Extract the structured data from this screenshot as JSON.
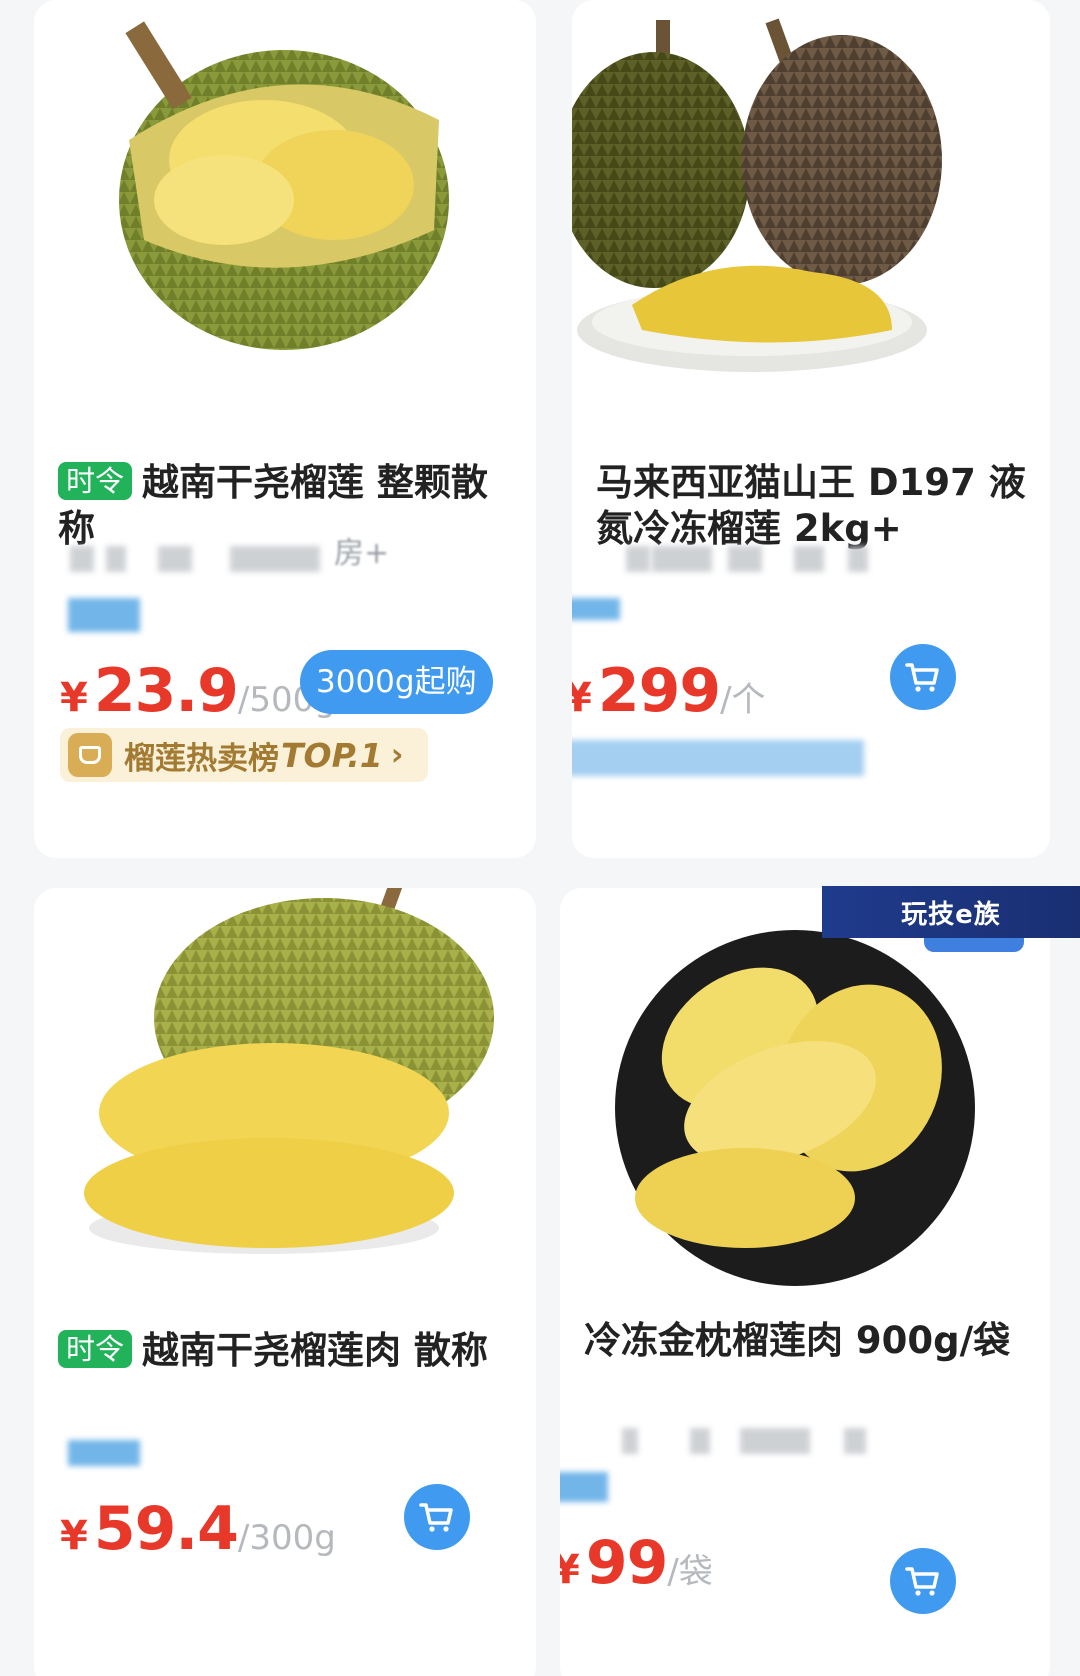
{
  "products": [
    {
      "tag": "时令",
      "title": "越南干尧榴莲 整颗散称",
      "blurred_fragment": "房+",
      "price_symbol": "¥",
      "price": "23.9",
      "unit": "/500g",
      "min_purchase": "3000g起购",
      "rank_label": "榴莲热卖榜",
      "rank_position": "TOP.1",
      "rank_arrow": "›"
    },
    {
      "title": "马来西亚猫山王 D197 液氮冷冻榴莲 2kg+",
      "price_symbol": "¥",
      "price": "299",
      "unit": "/个"
    },
    {
      "tag": "时令",
      "title": "越南干尧榴莲肉 散称",
      "price_symbol": "¥",
      "price": "59.4",
      "unit": "/300g"
    },
    {
      "title": "冷冻金枕榴莲肉 900g/袋",
      "price_symbol": "¥",
      "price": "99",
      "unit": "/袋"
    }
  ],
  "watermark": "玩技e族",
  "icons": [
    "cart-icon",
    "rank-crown-icon"
  ],
  "colors": {
    "price": "#e8382a",
    "accent": "#3f9af0",
    "tag": "#22b35a"
  }
}
